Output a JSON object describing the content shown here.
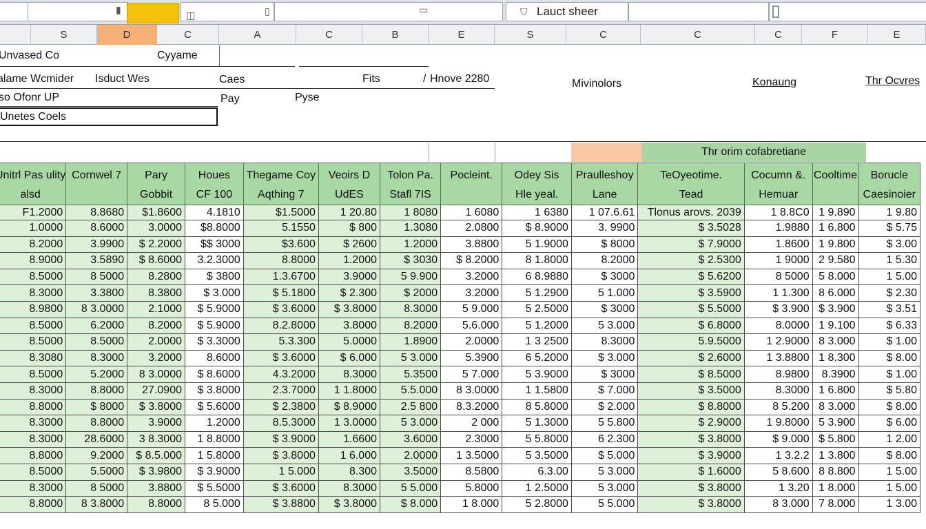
{
  "toolbar": {
    "box1_text": "",
    "box2_text": "",
    "box3_text": "",
    "box4_text": "",
    "search_text": "Lauct sheer",
    "colors": {
      "accent": "#f4c20d"
    }
  },
  "column_headers": [
    "S",
    "D",
    "C",
    "A",
    "C",
    "B",
    "E",
    "S",
    "C",
    "C",
    "C",
    "F",
    "E"
  ],
  "form": {
    "company_label": "Unvased Co",
    "company_value": "Cyyame",
    "line2_left": "alame Wcmider",
    "line2_mid": "Isduct Wes",
    "cases_label": "Caes",
    "fits_label": "Fits",
    "slash": "/",
    "hnove_label": "Hnove 2280",
    "mivinolors_label": "Mivinolors",
    "konaung_label": "Konaung",
    "thr_label": "Thr Ocvres",
    "line3_left": "so Ofonr UP",
    "pay_label": "Pay",
    "pyse_label": "Pyse",
    "boxed_label": "Unetes Coels"
  },
  "grid": {
    "band_title": "Thr orim  cofabretiane",
    "headers": [
      {
        "l1": "Unitrl Pas ulity",
        "l2": "alsd"
      },
      {
        "l1": "",
        "l2": "Cornwel 7"
      },
      {
        "l1": "Pary",
        "l2": "Gobbit"
      },
      {
        "l1": "Houes",
        "l2": "CF 100"
      },
      {
        "l1": "Thegame Coy",
        "l2": "Aqthing 7"
      },
      {
        "l1": "Veoirs D",
        "l2": "UdES"
      },
      {
        "l1": "Tolon Pa.",
        "l2": "Stafl 7IS"
      },
      {
        "l1": "Pocleint.",
        "l2": ""
      },
      {
        "l1": "Odey Sis",
        "l2": "Hle yeal."
      },
      {
        "l1": "Praulleshoy",
        "l2": "Lane"
      },
      {
        "l1": "TeOyeotime.",
        "l2": "Tead"
      },
      {
        "l1": "Cocumn &.",
        "l2": "Hemuar"
      },
      {
        "l1": "Cooltime",
        "l2": ""
      },
      {
        "l1": "Borucle",
        "l2": "Caesinoier"
      }
    ],
    "subheader": [
      "F1.2000",
      "8.8680",
      "$1.8600",
      "4.1810",
      "$1.5000",
      "1 20.80",
      "1 8080",
      "1 6080",
      "1 6380",
      "1 07.6.61",
      "Tlonus arovs. 2039",
      "1 8.8C0",
      "1 9.890",
      "1 9.80"
    ],
    "rows": [
      [
        "8.6000",
        "3.0000",
        "$8.8000",
        "5.1550",
        "$ 800",
        "1.3080",
        "2.0800",
        "$ 8.9000",
        "3. 9900",
        "$ 3.5028",
        "1.9880",
        "1 6.800",
        "$ 5.75"
      ],
      [
        "3.9900",
        "$ 2.2000",
        "$$ 3000",
        "$3.600",
        "$ 2600",
        "1.2000",
        "3.8800",
        "5 1.9000",
        "$ 8000",
        "$ 7.9000",
        "1.8600",
        "1 9.800",
        "$ 3.00"
      ],
      [
        "3.5890",
        "$ 8.6000",
        "3.2.3000",
        "8.8000",
        "1.2000",
        "$ 3030",
        "$ 8.2000",
        "8 1.8000",
        "8.2000",
        "$ 2.5300",
        "1 9000",
        "2 9.580",
        "1 5.30"
      ],
      [
        "8 5000",
        "8.2800",
        "$ 3800",
        "1.3.6700",
        "3.9000",
        "5 9.900",
        "3.2000",
        "6 8.9880",
        "$ 3000",
        "$ 5.6200",
        "8 5000",
        "5 8.000",
        "1 5.00"
      ],
      [
        "3.3800",
        "8.3800",
        "$ 3.000",
        "$ 5.1800",
        "$ 2.300",
        "$ 2000",
        "3.2000",
        "5 1.2900",
        "5 1.000",
        "$ 3.5900",
        "1 1.300",
        "8 6.000",
        "$ 2.30"
      ],
      [
        "8 3.0000",
        "2.1000",
        "$ 5.9000",
        "$ 3.6000",
        "$ 3.8000",
        "8.3000",
        "5 9.000",
        "5 2.5000",
        "$ 3000",
        "$ 5.5000",
        "$ 3.900",
        "$ 3.900",
        "$ 3.51"
      ],
      [
        "6.2000",
        "8.2000",
        "$ 5.9000",
        "8.2.8000",
        "3.8000",
        "8.2000",
        "5.6.000",
        "5 1.2000",
        "5 3.000",
        "$ 6.8000",
        "8.0000",
        "1 9.100",
        "$ 6.33"
      ],
      [
        "8.5000",
        "2.0000",
        "$ 3.3000",
        "5.3.300",
        "5.0000",
        "1.8900",
        "2.0000",
        "1 3 2500",
        "8.3000",
        "5.9.5000",
        "1 2.9000",
        "8 3.000",
        "$ 1.00"
      ],
      [
        "8.3000",
        "3.2000",
        "8.6000",
        "$ 3.6000",
        "$ 6.000",
        "5 3.000",
        "5.3900",
        "6 5.2000",
        "$ 3.000",
        "$ 2.6000",
        "1 3.8800",
        "1 8.300",
        "$ 8.00"
      ],
      [
        "5.2000",
        "8 3.0000",
        "$ 8.6000",
        "4.3.2000",
        "8.3000",
        "5.3500",
        "5 7.000",
        "5 3.9000",
        "$ 3000",
        "$ 8.5000",
        "8.9800",
        "8.3900",
        "$ 1.00"
      ],
      [
        "8.8000",
        "27.0900",
        "$ 3.8000",
        "2.3.7000",
        "1 1.8000",
        "5.5.000",
        "8 3.0000",
        "1 1.5800",
        "$ 7.000",
        "$ 3.5000",
        "8.3000",
        "1 6.800",
        "$ 5.80"
      ],
      [
        "$ 8000",
        "$ 3.8000",
        "$ 5.6000",
        "$ 2.3800",
        "$ 8.9000",
        "2.5 800",
        "8.3.2000",
        "8 5.8000",
        "$ 2.000",
        "$ 8.8000",
        "8 5.200",
        "8 3.000",
        "$ 8.00"
      ],
      [
        "8.8000",
        "3.9000",
        "1.2000",
        "8.5.3000",
        "1 3.0000",
        "5 3.000",
        "2 000",
        "5 1.3000",
        "5 5.800",
        "$ 2.9000",
        "1 9.8000",
        "5 3.900",
        "$ 6.00"
      ],
      [
        "28.6000",
        "3 8.3000",
        "1 8.8000",
        "$ 3.9000",
        "1.6600",
        "3.6000",
        "2.3000",
        "5 5.8000",
        "6 2.300",
        "$ 3.8000",
        "$ 9.000",
        "$ 5.800",
        "1 2.00"
      ],
      [
        "9.2000",
        "$ 8.5.000",
        "1 5.8000",
        "$ 3.8000",
        "1 6.000",
        "2.0000",
        "1 3.5000",
        "5 3.5000",
        "$ 5.000",
        "$ 3.9000",
        "1 3.2.2",
        "1 3.800",
        "$ 8.00"
      ],
      [
        "5.5000",
        "$ 3.9800",
        "$ 3.9000",
        "1 5.000",
        "8.300",
        "3.5000",
        "8.5800",
        "6.3.00",
        "5 3.000",
        "$ 1.6000",
        "5 8.600",
        "8 8.800",
        "1 5.00"
      ],
      [
        "8 5000",
        "3.8800",
        "$ 5.5000",
        "$ 3.6000",
        "8.3000",
        "5 5.000",
        "5.8000",
        "1 2.5000",
        "5 3.000",
        "$ 3.8000",
        "1 3.20",
        "1 8.000",
        "1 5.00"
      ],
      [
        "8 3.8000",
        "8.8000",
        "8 5.000",
        "$ 3.8800",
        "$ 3.8000",
        "$ 8.000",
        "1 8.000",
        "5 2.8000",
        "5 5.000",
        "$ 3.8000",
        "8 3.000",
        "7 8.000",
        "1 3.00"
      ]
    ],
    "left_partial": [
      "1.0000",
      "8.2000",
      "8.9000",
      "8.5000",
      "8.3000",
      "8.9800",
      "8.5000",
      "8.5000",
      "8.3080",
      "8.5000",
      "8.3000",
      "8.8000",
      "8.3000",
      "8.3000",
      "8.8000",
      "8.5000",
      "8.3000",
      "8.8000"
    ]
  }
}
